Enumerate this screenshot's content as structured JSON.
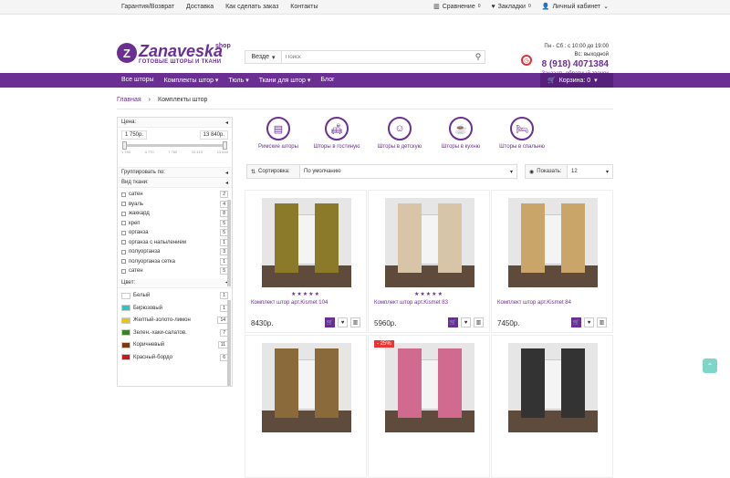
{
  "topbar": {
    "links": [
      "Гарантия/Возврат",
      "Доставка",
      "Как сделать заказ",
      "Контакты"
    ],
    "compare_label": "Сравнение",
    "compare_count": "0",
    "bookmarks_label": "Закладки",
    "bookmarks_count": "0",
    "account_label": "Личный кабинет"
  },
  "logo": {
    "mark": "Z",
    "name": "Zanaveska",
    "shop": "shop",
    "tagline": "ГОТОВЫЕ ШТОРЫ И ТКАНИ"
  },
  "search": {
    "scope": "Везде",
    "placeholder": "Поиск"
  },
  "contact": {
    "hours": "Пн - Сб : с 10:00 до 19:00",
    "sunday": "Вс: выходной",
    "phone": "8 (918) 4071384",
    "callback": "Заказать обратный звонок"
  },
  "nav": {
    "items": [
      "Все шторы",
      "Комплекты штор",
      "Тюль",
      "Ткани для штор",
      "Блог"
    ],
    "cart_label": "Корзина: 0"
  },
  "breadcrumb": {
    "home": "Главная",
    "current": "Комплекты штор"
  },
  "sidebar": {
    "price_title": "Цена:",
    "price_min": "1 750р.",
    "price_max": "13 840р.",
    "price_ticks": [
      "1 780",
      "4 770",
      "7 760",
      "10 410",
      "13 840"
    ],
    "group_title": "Группировать по:",
    "fabric_title": "Вид ткани:",
    "fabrics": [
      {
        "name": "сатен",
        "count": "2"
      },
      {
        "name": "вуаль",
        "count": "4"
      },
      {
        "name": "жаккард",
        "count": "8"
      },
      {
        "name": "креп",
        "count": "5"
      },
      {
        "name": "органза",
        "count": "5"
      },
      {
        "name": "органза с напылением",
        "count": "1"
      },
      {
        "name": "полуорганза",
        "count": "3"
      },
      {
        "name": "полуорганза сетка",
        "count": "1"
      },
      {
        "name": "сатен",
        "count": "5"
      }
    ],
    "color_title": "Цвет:",
    "colors": [
      {
        "name": "Белый",
        "count": "1",
        "hex": "#ffffff"
      },
      {
        "name": "Бирюзовый",
        "count": "1",
        "hex": "#2ec4c0"
      },
      {
        "name": "Желтый-золото-лимон",
        "count": "14",
        "hex": "#e8c21c"
      },
      {
        "name": "Зелен.-хаки-салатов.",
        "count": "7",
        "hex": "#3d7f2a"
      },
      {
        "name": "Коричневый",
        "count": "11",
        "hex": "#7a3b14"
      },
      {
        "name": "Красный-бордо",
        "count": "6",
        "hex": "#c41a1a"
      }
    ]
  },
  "categories": [
    {
      "label": "Римские шторы",
      "icon": "roman-blind-icon"
    },
    {
      "label": "Шторы в гостиную",
      "icon": "living-room-icon"
    },
    {
      "label": "Шторы в детскую",
      "icon": "kids-room-icon"
    },
    {
      "label": "Шторы в кухню",
      "icon": "kitchen-icon"
    },
    {
      "label": "Шторы в спальню",
      "icon": "bedroom-icon"
    }
  ],
  "sort": {
    "label": "Сортировка:",
    "value": "По умолчанию",
    "show_label": "Показать:",
    "show_value": "12"
  },
  "products": [
    {
      "name": "Комплект штор арт.Kismet 104",
      "price": "8430р.",
      "stars": "★★★★★",
      "curtain": "#8a7a2a"
    },
    {
      "name": "Комплект штор арт.Kismet 83",
      "price": "5960р.",
      "stars": "★★★★★",
      "curtain": "#d8c5a8"
    },
    {
      "name": "Комплект штор арт.Kismet 84",
      "price": "7450р.",
      "stars": "",
      "curtain": "#c9a56a"
    },
    {
      "name": "",
      "price": "",
      "stars": "",
      "curtain": "#8a6a3a",
      "badge": ""
    },
    {
      "name": "",
      "price": "",
      "stars": "",
      "curtain": "#d06a8e",
      "badge": "- 25%"
    },
    {
      "name": "",
      "price": "",
      "stars": "",
      "curtain": "#333333"
    }
  ],
  "colors": {
    "brand": "#6b2f93"
  }
}
